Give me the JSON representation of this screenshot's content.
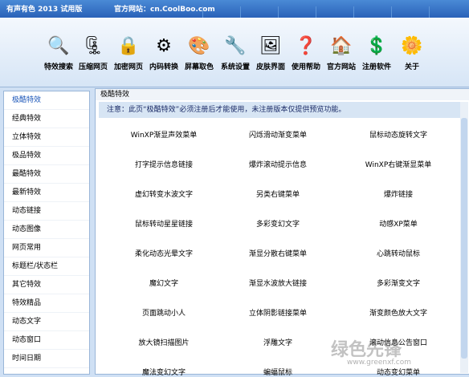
{
  "window": {
    "title": "有声有色 2013 试用版",
    "site": "官方网站：cn.CoolBoo.com"
  },
  "toolbar": [
    {
      "label": "特效搜索",
      "icon": "search-icon",
      "glyph": "🔍"
    },
    {
      "label": "压缩网页",
      "icon": "zip-icon",
      "glyph": "🗜"
    },
    {
      "label": "加密网页",
      "icon": "lock-icon",
      "glyph": "🔒"
    },
    {
      "label": "内码转换",
      "icon": "gear-icon",
      "glyph": "⚙"
    },
    {
      "label": "屏幕取色",
      "icon": "palette-icon",
      "glyph": "🎨"
    },
    {
      "label": "系统设置",
      "icon": "tools-icon",
      "glyph": "🔧"
    },
    {
      "label": "皮肤界面",
      "icon": "skin-icon",
      "glyph": "🖼"
    },
    {
      "label": "使用帮助",
      "icon": "help-icon",
      "glyph": "❓"
    },
    {
      "label": "官方网站",
      "icon": "home-icon",
      "glyph": "🏠"
    },
    {
      "label": "注册软件",
      "icon": "dollar-icon",
      "glyph": "💲"
    },
    {
      "label": "关于",
      "icon": "flower-icon",
      "glyph": "🌼"
    }
  ],
  "sidebar": [
    "极酷特效",
    "经典特效",
    "立体特效",
    "极品特效",
    "最酷特效",
    "最新特效",
    "动态链接",
    "动态图像",
    "网页常用",
    "标题栏/状态栏",
    "其它特效",
    "特效精品",
    "动态文字",
    "动态窗口",
    "时间日期"
  ],
  "main": {
    "heading": "极酷特效",
    "notice": "注意：此页“极酷特效”必须注册后才能使用，未注册版本仅提供预览功能。",
    "rows": [
      [
        "WinXP渐显声效菜单",
        "闪烁滑动渐变菜单",
        "鼠标动态旋转文字"
      ],
      [
        "打字提示信息链接",
        "爆炸滚动提示信息",
        "WinXP右键渐显菜单"
      ],
      [
        "虚幻转变水波文字",
        "另类右键菜单",
        "爆炸链接"
      ],
      [
        "鼠标转动星星链接",
        "多彩变幻文字",
        "动感XP菜单"
      ],
      [
        "柔化动态光晕文字",
        "渐显分散右键菜单",
        "心跳转动鼠标"
      ],
      [
        "魔幻文字",
        "渐显水波放大链接",
        "多彩渐变文字"
      ],
      [
        "页面跳动小人",
        "立体阴影链接菜单",
        "渐变颜色放大文字"
      ],
      [
        "放大镜扫描图片",
        "浮雕文字",
        "滚动信息公告窗口"
      ],
      [
        "魔法变幻文字",
        "蝙蝠鼠标",
        "动态变幻菜单"
      ]
    ]
  },
  "watermark": {
    "brand": "绿色先锋",
    "url": "www.greenxf.com"
  }
}
